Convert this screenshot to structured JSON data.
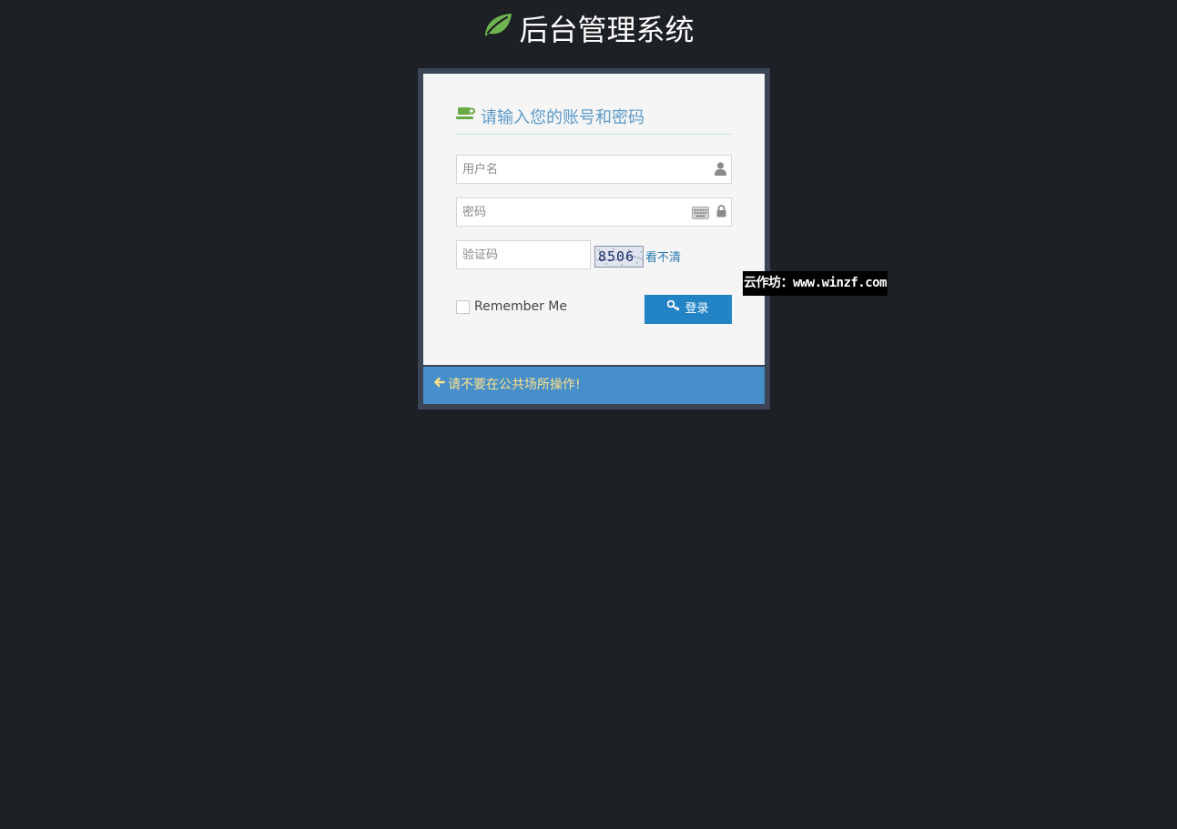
{
  "app": {
    "title": "后台管理系统",
    "icon": "leaf-icon",
    "leaf_color": "#6fb44f"
  },
  "login": {
    "heading": "请输入您的账号和密码",
    "heading_icon": "coffee-cup-icon",
    "username_placeholder": "用户名",
    "password_placeholder": "密码",
    "captcha_placeholder": "验证码",
    "captcha_code": "8506",
    "captcha_refresh": "看不清",
    "remember_label": "Remember Me",
    "submit_label": "登录",
    "button_color": "#2283c5"
  },
  "footer": {
    "warning": "请不要在公共场所操作!",
    "bar_color": "#478fca",
    "text_color": "#fee188"
  },
  "watermark": {
    "text": "云作坊：www.winzf.com"
  }
}
